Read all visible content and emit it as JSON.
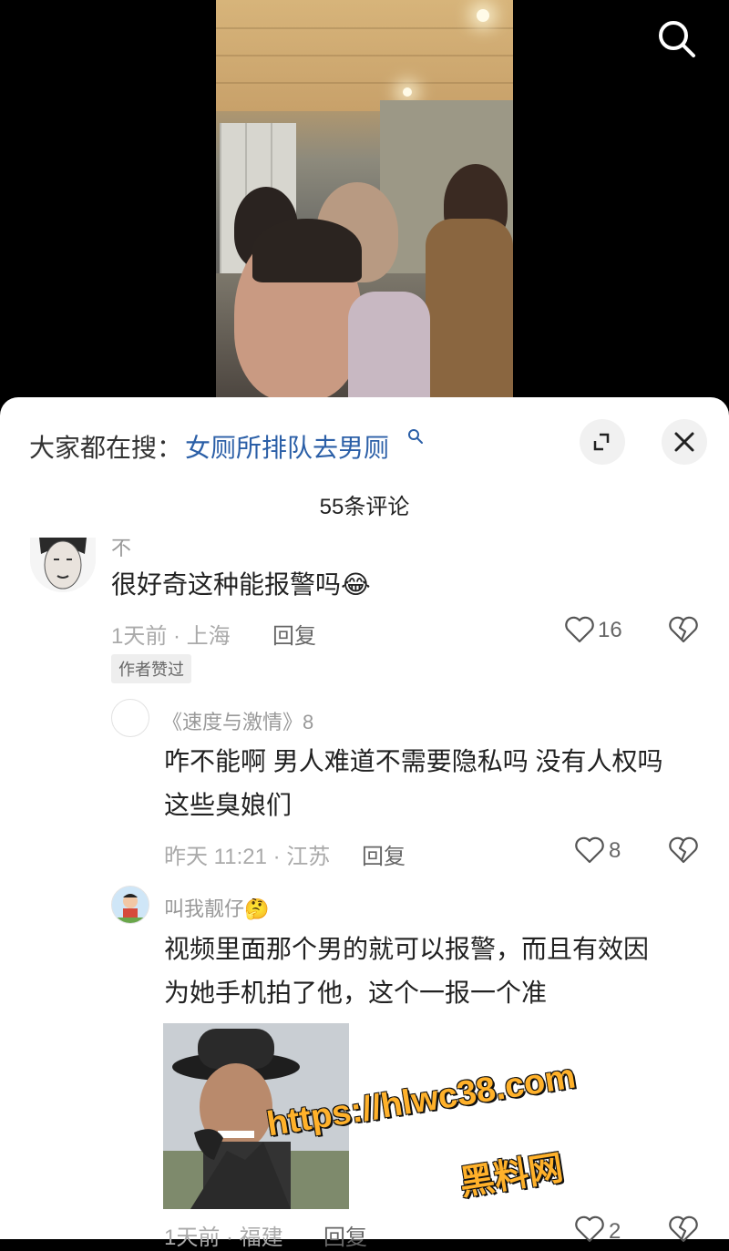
{
  "header": {
    "hot_search_prefix": "大家都在搜：",
    "hot_search_term": "女厕所排队去男厕",
    "icons": {
      "search": "search-icon",
      "expand": "expand-icon",
      "close": "close-icon"
    }
  },
  "comments_header": {
    "count_text": "55条评论"
  },
  "comments": [
    {
      "username": "不",
      "text": "很好奇这种能报警吗",
      "emoji": "😂",
      "time_location": "1天前 · 上海",
      "reply_label": "回复",
      "likes": "16",
      "badge": "作者赞过"
    }
  ],
  "replies": [
    {
      "username": "《速度与激情》8",
      "text_line1": "咋不能啊 男人难道不需要隐私吗 没有人权吗",
      "text_line2": "这些臭娘们",
      "time_location": "昨天 11:21 · 江苏",
      "reply_label": "回复",
      "likes": "8"
    },
    {
      "username": "叫我靓仔",
      "emoji": "🤔",
      "text_line1": "视频里面那个男的就可以报警，而且有效因",
      "text_line2": "为她手机拍了他，这个一报一个准",
      "time_location": "1天前 · 福建",
      "reply_label": "回复",
      "likes": "2"
    }
  ],
  "watermark": {
    "url": "https://hlwc38.com",
    "site": "黑料网"
  }
}
